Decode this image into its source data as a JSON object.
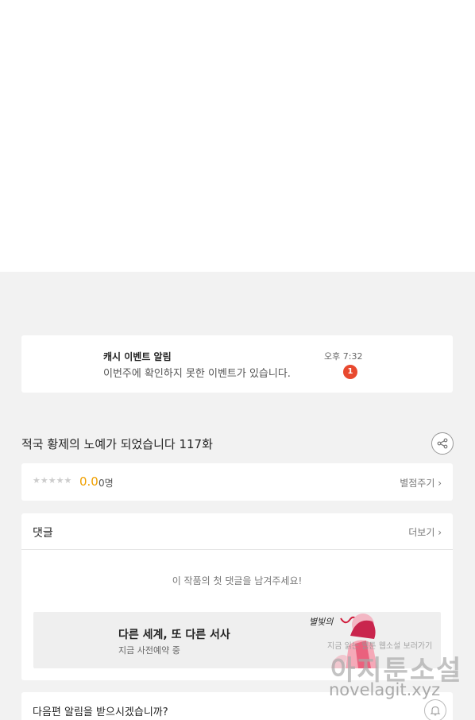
{
  "notice": {
    "title": "캐시 이벤트 알림",
    "time": "오후 7:32",
    "body": "이번주에 확인하지 못한 이벤트가 있습니다.",
    "badge": "1"
  },
  "episode": {
    "title": "적국 황제의 노예가 되었습니다 117화",
    "share_icon": "share-icon"
  },
  "rating": {
    "stars": "★★★★★",
    "score": "0.0",
    "count": "0명",
    "rate_label": "별점주기 ›"
  },
  "comments": {
    "title": "댓글",
    "more_label": "더보기 ›",
    "empty_text": "이 작품의 첫 댓글을 남겨주세요!"
  },
  "banner": {
    "title": "다른 세계, 또 다른 서사",
    "subtitle": "지금 사전예약 중",
    "art_label": "별빛의 W"
  },
  "alarm": {
    "text": "다음편 알림을 받으시겠습니까?",
    "bell_icon": "bell-icon"
  },
  "watermark": {
    "tagline": "지금 읽는 웹툰 웹소설 보러가기",
    "brand": "아지툰소설",
    "url": "novelagit.xyz"
  },
  "colors": {
    "accent_orange": "#f0a000",
    "badge_red": "#e8492f",
    "background_gray": "#f2f2f2"
  }
}
